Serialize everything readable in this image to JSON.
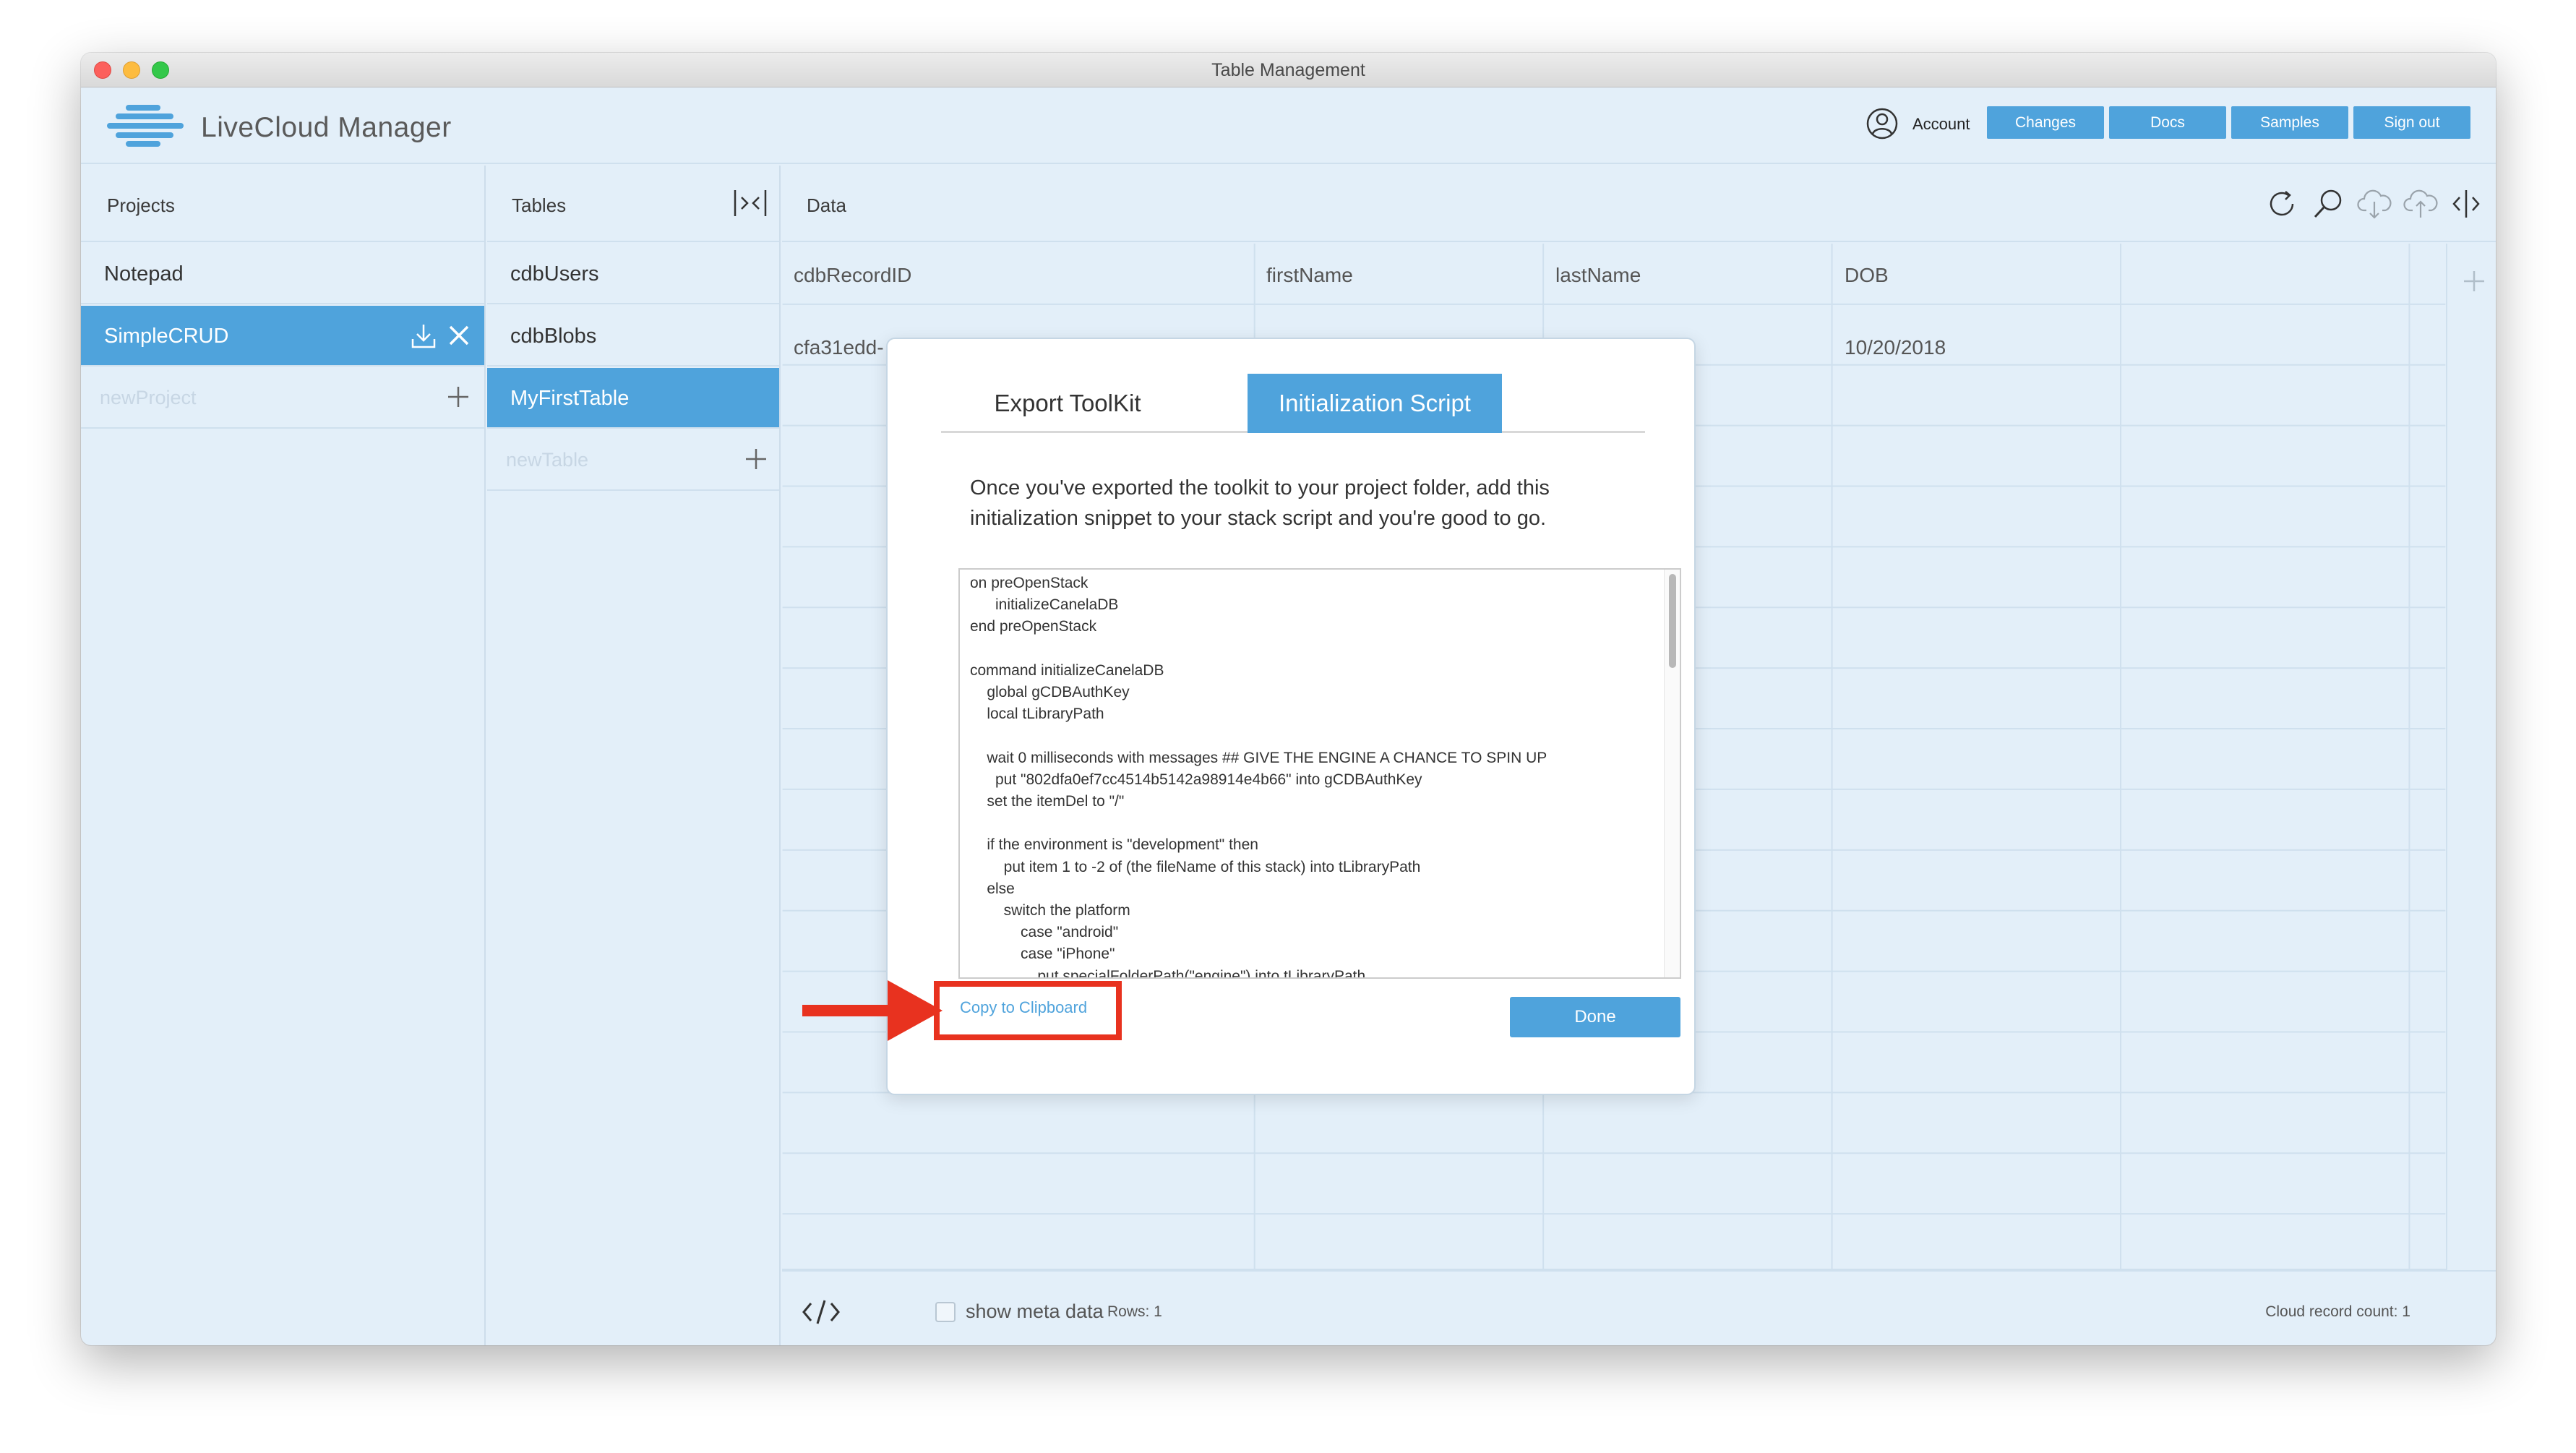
{
  "window": {
    "title": "Table Management"
  },
  "header": {
    "app_name": "LiveCloud Manager",
    "account_label": "Account",
    "buttons": {
      "changes": "Changes",
      "docs": "Docs",
      "samples": "Samples",
      "sign_out": "Sign out"
    }
  },
  "projects": {
    "header": "Projects",
    "items": [
      "Notepad",
      "SimpleCRUD"
    ],
    "selected": "SimpleCRUD",
    "new_placeholder": "newProject"
  },
  "tables": {
    "header": "Tables",
    "items": [
      "cdbUsers",
      "cdbBlobs",
      "MyFirstTable"
    ],
    "selected": "MyFirstTable",
    "new_placeholder": "newTable"
  },
  "data": {
    "header": "Data",
    "columns": [
      "cdbRecordID",
      "firstName",
      "lastName",
      "DOB"
    ],
    "rows": [
      [
        "cfa31edd-",
        "",
        "",
        "10/20/2018"
      ]
    ]
  },
  "footer": {
    "show_meta_label": "show meta data",
    "rows_label": "Rows: 1",
    "cloud_count_label": "Cloud record count: 1"
  },
  "modal": {
    "tabs": [
      "Export ToolKit",
      "Initialization Script"
    ],
    "active_tab": "Initialization Script",
    "intro": "Once you've exported the toolkit to your project folder, add this initialization snippet to your stack script and you're good to go.",
    "code": "on preOpenStack\n      initializeCanelaDB\nend preOpenStack\n\ncommand initializeCanelaDB\n    global gCDBAuthKey\n    local tLibraryPath\n\n    wait 0 milliseconds with messages ## GIVE THE ENGINE A CHANCE TO SPIN UP\n      put \"802dfa0ef7cc4514b5142a98914e4b66\" into gCDBAuthKey\n    set the itemDel to \"/\"\n\n    if the environment is \"development\" then\n        put item 1 to -2 of (the fileName of this stack) into tLibraryPath\n    else\n        switch the platform\n            case \"android\"\n            case \"iPhone\"\n                put specialFolderPath(\"engine\") into tLibraryPath",
    "copy_label": "Copy to Clipboard",
    "done_label": "Done"
  },
  "colors": {
    "accent": "#4fa3dc",
    "app_background": "#e3eff9",
    "highlight": "#e8321f"
  }
}
